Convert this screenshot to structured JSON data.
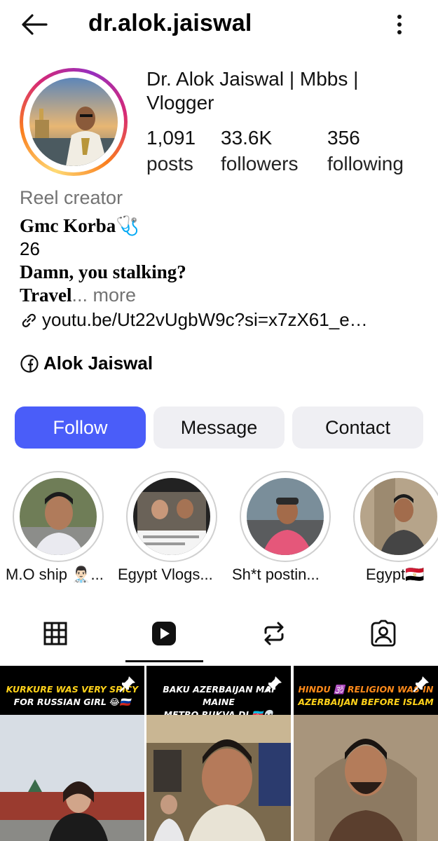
{
  "header": {
    "username": "dr.alok.jaiswal"
  },
  "profile": {
    "display_name": "Dr. Alok Jaiswal | Mbbs | Vlogger",
    "stats": [
      {
        "value": "1,091",
        "label": "posts"
      },
      {
        "value": "33.6K",
        "label": "followers"
      },
      {
        "value": "356",
        "label": "following"
      }
    ],
    "category": "Reel creator",
    "bio": {
      "line1": "Gmc Korba",
      "line1_emoji": "🩺",
      "line2": "26",
      "line3": "Damn, you stalking?",
      "line4": "Travel",
      "ellipsis": "...",
      "more": " more"
    },
    "link": "youtu.be/Ut22vUgbW9c?si=x7zX61_e…",
    "facebook": "Alok Jaiswal"
  },
  "buttons": {
    "follow": "Follow",
    "message": "Message",
    "contact": "Contact"
  },
  "highlights": [
    {
      "label": "M.O ship 👨🏻‍⚕️..."
    },
    {
      "label": "Egypt Vlogs..."
    },
    {
      "label": "Sh*t postin..."
    },
    {
      "label": "Egypt🇪🇬"
    }
  ],
  "tabs": [
    "grid",
    "reels",
    "reposts",
    "tagged"
  ],
  "tiles": [
    {
      "caption_a": "KURKURE WAS VERY SPICY",
      "caption_b": "FOR RUSSIAN GIRL 😂🇷🇺"
    },
    {
      "caption_a": "BAKU AZERBAIJAN MAI MAINE",
      "caption_b": "METRO RUKVA DI 🇦🇿💀"
    },
    {
      "caption_a": "HINDU 🕉️ RELIGION WAS IN",
      "caption_b": "AZERBAIJAN BEFORE ISLAM"
    }
  ],
  "colors": {
    "accent": "#4a5df9",
    "button_gray": "#efeff3",
    "muted": "#737373",
    "caption_yellow": "#ffd21a"
  }
}
